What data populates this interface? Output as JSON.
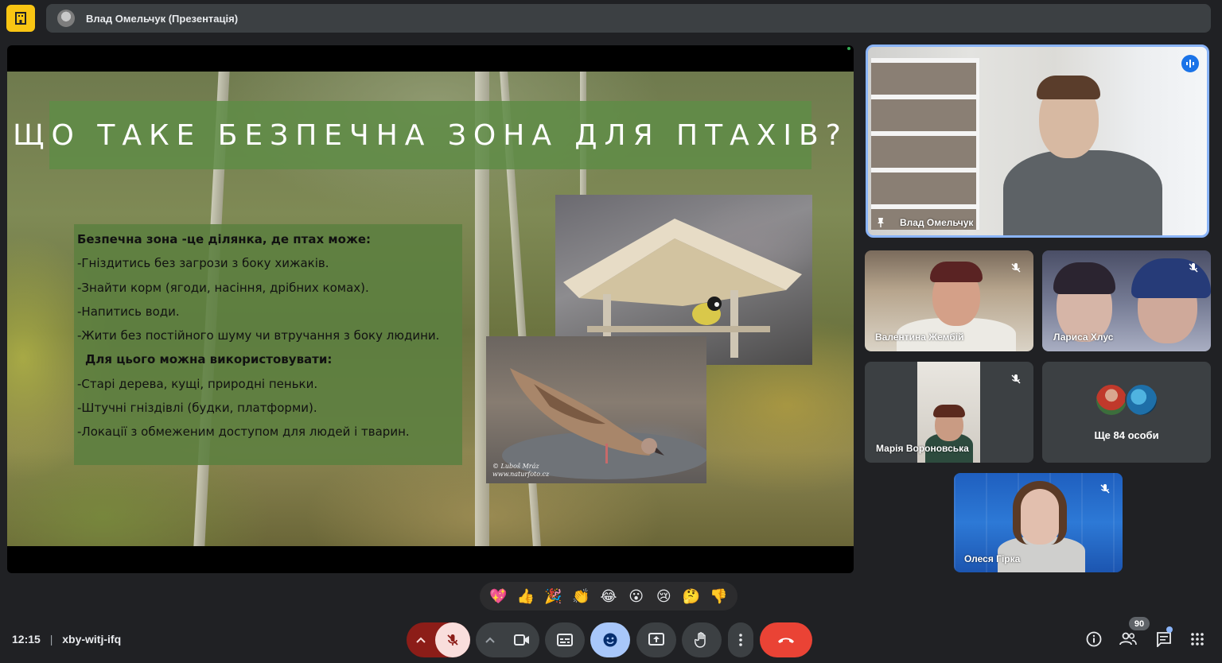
{
  "header": {
    "presenter_title": "Влад Омельчук (Презентація)"
  },
  "slide": {
    "title": "ЩО ТАКЕ БЕЗПЕЧНА ЗОНА ДЛЯ ПТАХІВ?",
    "lines": [
      "Безпечна зона -це ділянка, де птах може:",
      "-Гніздитись без загрози з боку хижаків.",
      "-Знайти корм (ягоди, насіння, дрібних комах).",
      "-Напитись води.",
      "-Жити без постійного шуму чи втручання з боку людини.",
      "Для цього можна використовувати:",
      "-Старі дерева, кущі, природні пеньки.",
      "-Штучні гніздівлі (будки, платформи).",
      "-Локації з обмеженим доступом для людей і тварин."
    ],
    "photo_credit_line1": "© Luboš Mráz",
    "photo_credit_line2": "www.naturfoto.cz"
  },
  "participants": {
    "speaker": "Влад Омельчук",
    "valentyna": "Валентина Жембій",
    "larysa": "Лариса Хлус",
    "mariya": "Марія Вороновська",
    "olesya": "Олеся Гірка",
    "more": "Ще 84 особи",
    "count": "90"
  },
  "reactions": [
    "💖",
    "👍",
    "🎉",
    "👏",
    "😂",
    "😮",
    "😢",
    "🤔",
    "👎"
  ],
  "footer": {
    "time": "12:15",
    "separator": "|",
    "meeting_code": "xby-witj-ifq"
  },
  "colors": {
    "background": "#202124",
    "tile": "#3c4043",
    "accent_blue": "#8ab4f8",
    "leave_red": "#ea4335",
    "mic_off_bg": "#f9dedc",
    "mic_off_dark": "#8c1d18",
    "active_blue": "#a8c7fa",
    "home_yellow": "#f9c513"
  }
}
